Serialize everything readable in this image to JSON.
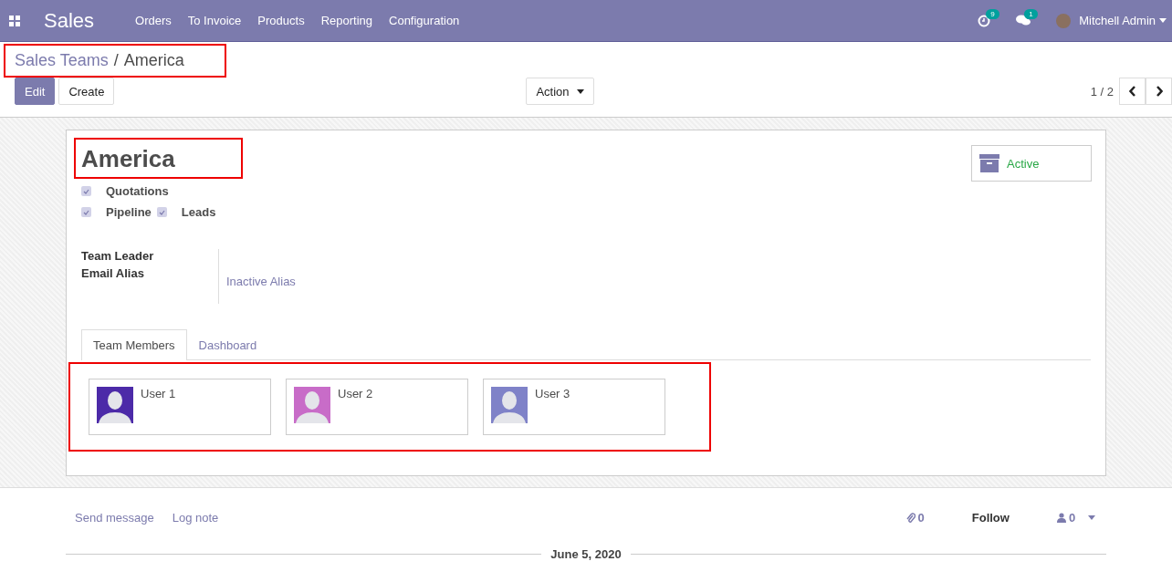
{
  "navbar": {
    "app": "Sales",
    "menu": [
      "Orders",
      "To Invoice",
      "Products",
      "Reporting",
      "Configuration"
    ],
    "activity_count": "9",
    "message_count": "1",
    "user": "Mitchell Admin"
  },
  "breadcrumb": {
    "parent": "Sales Teams",
    "separator": "/",
    "current": "America",
    "highlighted": true
  },
  "buttons": {
    "edit": "Edit",
    "create": "Create",
    "action": "Action"
  },
  "pager": "1 / 2",
  "record": {
    "name": "America",
    "name_highlighted": true,
    "status": "Active",
    "checkbox_rows": [
      [
        {
          "label": "Quotations",
          "checked": true
        }
      ],
      [
        {
          "label": "Pipeline",
          "checked": true
        },
        {
          "label": "Leads",
          "checked": true
        }
      ]
    ],
    "fields": [
      {
        "label": "Team Leader"
      },
      {
        "label": "Email Alias",
        "value": "Inactive Alias"
      }
    ],
    "tabs": [
      {
        "label": "Team Members",
        "selected": true
      },
      {
        "label": "Dashboard",
        "selected": false
      }
    ],
    "members_highlighted": true,
    "members": [
      {
        "name": "User 1",
        "color": "#4c2aa8"
      },
      {
        "name": "User 2",
        "color": "#c86cc8"
      },
      {
        "name": "User 3",
        "color": "#7f82c8"
      }
    ]
  },
  "chatter": {
    "send": "Send message",
    "log": "Log note",
    "attachments": "0",
    "follow": "Follow",
    "followers": "0",
    "date": "June 5, 2020"
  }
}
